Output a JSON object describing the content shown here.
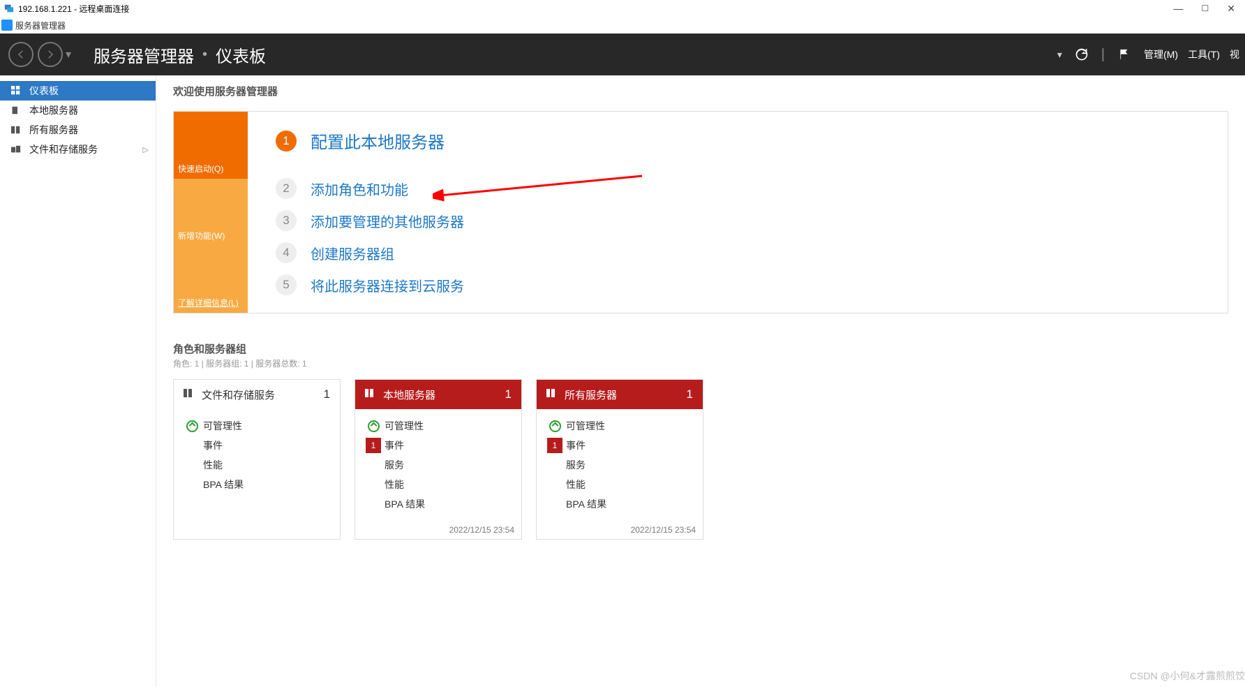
{
  "rdp": {
    "title": "192.168.1.221 - 远程桌面连接"
  },
  "app": {
    "title": "服务器管理器"
  },
  "header": {
    "bc1": "服务器管理器",
    "bc2": "仪表板",
    "menu_manage": "管理(M)",
    "menu_tools": "工具(T)",
    "menu_view": "视"
  },
  "sidebar": [
    {
      "label": "仪表板",
      "selected": true,
      "icon": "dashboard"
    },
    {
      "label": "本地服务器",
      "selected": false,
      "icon": "server"
    },
    {
      "label": "所有服务器",
      "selected": false,
      "icon": "servers"
    },
    {
      "label": "文件和存储服务",
      "selected": false,
      "icon": "storage",
      "expandable": true
    }
  ],
  "welcome": {
    "heading": "欢迎使用服务器管理器",
    "tabs": {
      "quick": "快速启动(Q)",
      "new": "新增功能(W)",
      "learn": "了解详细信息(L)"
    },
    "steps": [
      {
        "n": "1",
        "label": "配置此本地服务器",
        "primary": true
      },
      {
        "n": "2",
        "label": "添加角色和功能"
      },
      {
        "n": "3",
        "label": "添加要管理的其他服务器"
      },
      {
        "n": "4",
        "label": "创建服务器组"
      },
      {
        "n": "5",
        "label": "将此服务器连接到云服务"
      }
    ]
  },
  "groups": {
    "title": "角色和服务器组",
    "sub": "角色: 1 | 服务器组: 1 | 服务器总数: 1",
    "tiles": [
      {
        "title": "文件和存储服务",
        "count": "1",
        "style": "light",
        "rows": [
          {
            "type": "ok",
            "label": "可管理性"
          },
          {
            "type": "plain",
            "label": "事件"
          },
          {
            "type": "plain",
            "label": "性能"
          },
          {
            "type": "plain",
            "label": "BPA 结果"
          }
        ],
        "date": ""
      },
      {
        "title": "本地服务器",
        "count": "1",
        "style": "dark",
        "rows": [
          {
            "type": "ok",
            "label": "可管理性"
          },
          {
            "type": "bad",
            "badge": "1",
            "label": "事件"
          },
          {
            "type": "plain",
            "label": "服务"
          },
          {
            "type": "plain",
            "label": "性能"
          },
          {
            "type": "plain",
            "label": "BPA 结果"
          }
        ],
        "date": "2022/12/15 23:54"
      },
      {
        "title": "所有服务器",
        "count": "1",
        "style": "dark",
        "rows": [
          {
            "type": "ok",
            "label": "可管理性"
          },
          {
            "type": "bad",
            "badge": "1",
            "label": "事件"
          },
          {
            "type": "plain",
            "label": "服务"
          },
          {
            "type": "plain",
            "label": "性能"
          },
          {
            "type": "plain",
            "label": "BPA 结果"
          }
        ],
        "date": "2022/12/15 23:54"
      }
    ]
  },
  "watermark": "CSDN @小何&才露煎煎饺"
}
